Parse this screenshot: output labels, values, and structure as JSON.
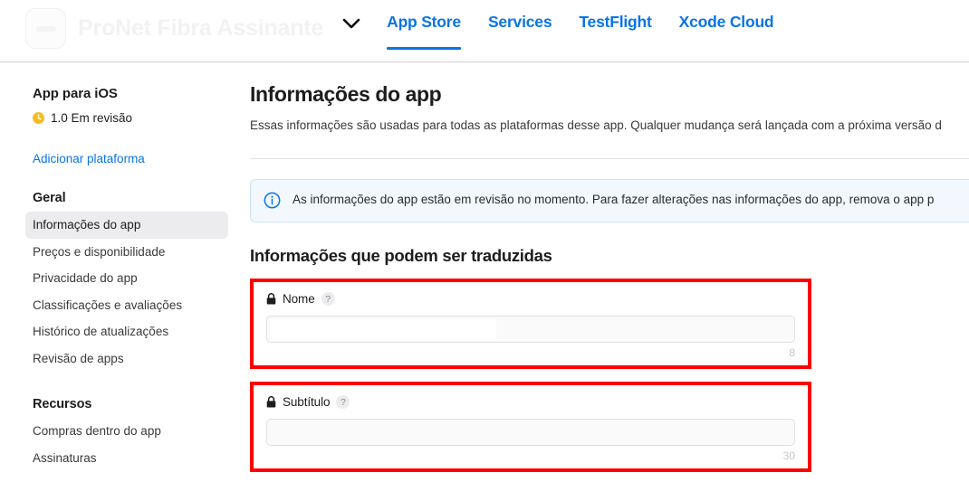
{
  "header": {
    "app_icon": "app-icon-placeholder",
    "app_title": "ProNet Fibra Assinante",
    "chevron_icon": "chevron-down-icon",
    "tabs": [
      {
        "label": "App Store",
        "active": true
      },
      {
        "label": "Services",
        "active": false
      },
      {
        "label": "TestFlight",
        "active": false
      },
      {
        "label": "Xcode Cloud",
        "active": false
      }
    ],
    "accent_color": "#0a74e6"
  },
  "sidebar": {
    "platform_title": "App para iOS",
    "status_icon": "clock-icon",
    "status_color": "#f5bd1f",
    "status_text": "1.0 Em revisão",
    "add_platform_label": "Adicionar plataforma",
    "groups": [
      {
        "title": "Geral",
        "items": [
          {
            "label": "Informações do app",
            "active": true
          },
          {
            "label": "Preços e disponibilidade",
            "active": false
          },
          {
            "label": "Privacidade do app",
            "active": false
          },
          {
            "label": "Classificações e avaliações",
            "active": false
          },
          {
            "label": "Histórico de atualizações",
            "active": false
          },
          {
            "label": "Revisão de apps",
            "active": false
          }
        ]
      },
      {
        "title": "Recursos",
        "items": [
          {
            "label": "Compras dentro do app",
            "active": false
          },
          {
            "label": "Assinaturas",
            "active": false
          }
        ]
      }
    ]
  },
  "main": {
    "title": "Informações do app",
    "description": "Essas informações são usadas para todas as plataformas desse app. Qualquer mudança será lançada com a próxima versão d",
    "banner": {
      "icon": "info-circle-icon",
      "icon_color": "#0a74e6",
      "text": "As informações do app estão em revisão no momento. Para fazer alterações nas informações do app, remova o app p",
      "background_color": "#f2f8fe",
      "border_color": "#cfe3f8"
    },
    "section_title": "Informações que podem ser traduzidas",
    "highlight_color": "#ff0000",
    "fields": [
      {
        "lock_icon": "lock-icon",
        "label": "Nome",
        "help_icon": "question-mark-icon",
        "value": "",
        "redacted": true,
        "counter": "8",
        "disabled": true
      },
      {
        "lock_icon": "lock-icon",
        "label": "Subtítulo",
        "help_icon": "question-mark-icon",
        "value": "",
        "redacted": false,
        "counter": "30",
        "disabled": true
      }
    ]
  }
}
